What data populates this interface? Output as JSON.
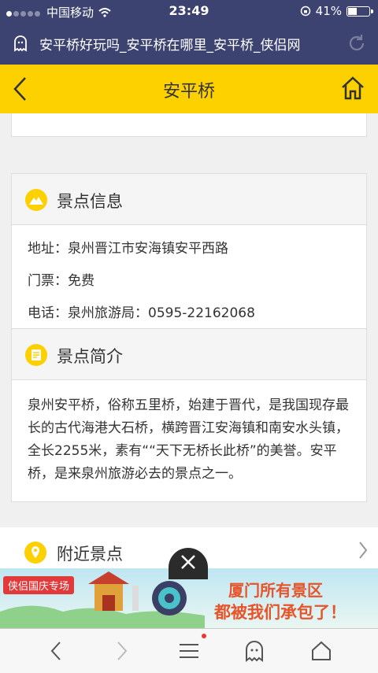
{
  "status": {
    "carrier": "中国移动",
    "time": "23:49",
    "battery": "41%"
  },
  "browser": {
    "page_title": "安平桥好玩吗_安平桥在哪里_安平桥_侠侣网"
  },
  "header": {
    "title": "安平桥"
  },
  "info_section": {
    "title": "景点信息",
    "address": "地址：泉州晋江市安海镇安平西路",
    "ticket": "门票：免费",
    "phone": "电话：泉州旅游局：0595-22162068"
  },
  "intro_section": {
    "title": "景点简介",
    "text": "泉州安平桥，俗称五里桥，始建于晋代，是我国现存最长的古代海港大石桥，横跨晋江安海镇和南安水头镇，全长2255米，素有““天下无桥长此桥”的美誉。安平桥，是来泉州旅游必去的景点之一。"
  },
  "nearby_section": {
    "title": "附近景点"
  },
  "ad": {
    "tag": "侠侣国庆专场",
    "line1": "厦门所有景区",
    "line2": "都被我们承包了！"
  },
  "colors": {
    "brand_yellow": "#fdd000",
    "browser_bar": "#3d4370",
    "ad_text": "#e8542a"
  }
}
